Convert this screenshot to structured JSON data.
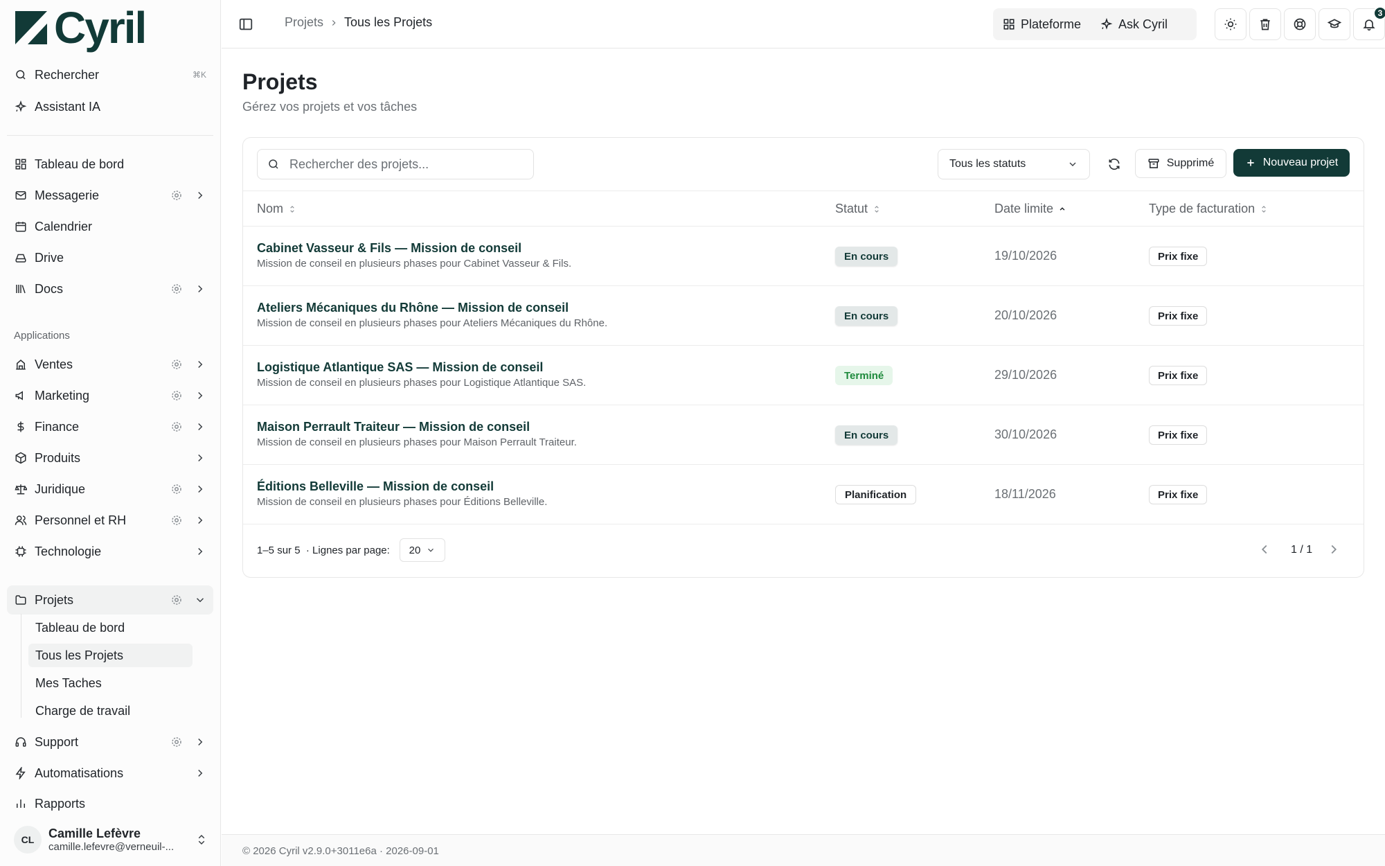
{
  "app": {
    "name": "Cyril"
  },
  "sidebar": {
    "search_label": "Rechercher",
    "search_shortcut": "⌘K",
    "assistant_label": "Assistant IA",
    "main_items": [
      {
        "label": "Tableau de bord",
        "icon": "dashboard-icon"
      },
      {
        "label": "Messagerie",
        "icon": "mail-icon"
      },
      {
        "label": "Calendrier",
        "icon": "calendar-icon"
      },
      {
        "label": "Drive",
        "icon": "drive-icon"
      },
      {
        "label": "Docs",
        "icon": "library-icon"
      }
    ],
    "applications_label": "Applications",
    "app_items": [
      {
        "label": "Ventes",
        "icon": "scales-icon"
      },
      {
        "label": "Marketing",
        "icon": "megaphone-icon"
      },
      {
        "label": "Finance",
        "icon": "dollar-icon"
      },
      {
        "label": "Produits",
        "icon": "box-icon"
      },
      {
        "label": "Juridique",
        "icon": "balance-icon"
      },
      {
        "label": "Personnel et RH",
        "icon": "users-icon"
      },
      {
        "label": "Technologie",
        "icon": "chip-icon"
      }
    ],
    "projects": {
      "label": "Projets",
      "sub_items": [
        "Tableau de bord",
        "Tous les Projets",
        "Mes Taches",
        "Charge de travail"
      ],
      "active_sub": "Tous les Projets"
    },
    "bottom_items": [
      {
        "label": "Support",
        "icon": "headset-icon"
      },
      {
        "label": "Automatisations",
        "icon": "bolt-icon"
      },
      {
        "label": "Rapports",
        "icon": "bar-chart-icon"
      }
    ],
    "user": {
      "initials": "CL",
      "name": "Camille Lefèvre",
      "email": "camille.lefevre@verneuil-..."
    }
  },
  "header": {
    "breadcrumb": [
      "Projets",
      "Tous les Projets"
    ],
    "platform_label": "Plateforme",
    "ask_label": "Ask Cyril",
    "notification_count": "3"
  },
  "main": {
    "title": "Projets",
    "subtitle": "Gérez vos projets et vos tâches",
    "search_placeholder": "Rechercher des projets...",
    "status_filter": "Tous les statuts",
    "deleted_label": "Supprimé",
    "new_project_label": "Nouveau projet",
    "columns": {
      "name": "Nom",
      "status": "Statut",
      "deadline": "Date limite",
      "billing": "Type de facturation"
    },
    "rows": [
      {
        "name": "Cabinet Vasseur & Fils — Mission de conseil",
        "description": "Mission de conseil en plusieurs phases pour Cabinet Vasseur & Fils.",
        "status": "En cours",
        "deadline": "19/10/2026",
        "billing": "Prix fixe"
      },
      {
        "name": "Ateliers Mécaniques du Rhône — Mission de conseil",
        "description": "Mission de conseil en plusieurs phases pour Ateliers Mécaniques du Rhône.",
        "status": "En cours",
        "deadline": "20/10/2026",
        "billing": "Prix fixe"
      },
      {
        "name": "Logistique Atlantique SAS — Mission de conseil",
        "description": "Mission de conseil en plusieurs phases pour Logistique Atlantique SAS.",
        "status": "Terminé",
        "deadline": "29/10/2026",
        "billing": "Prix fixe"
      },
      {
        "name": "Maison Perrault Traiteur — Mission de conseil",
        "description": "Mission de conseil en plusieurs phases pour Maison Perrault Traiteur.",
        "status": "En cours",
        "deadline": "30/10/2026",
        "billing": "Prix fixe"
      },
      {
        "name": "Éditions Belleville — Mission de conseil",
        "description": "Mission de conseil en plusieurs phases pour Éditions Belleville.",
        "status": "Planification",
        "deadline": "18/11/2026",
        "billing": "Prix fixe"
      }
    ],
    "pagination": {
      "range": "1–5 sur 5",
      "rows_per_page_label": "· Lignes par page:",
      "rows_per_page": "20",
      "page": "1 / 1"
    }
  },
  "footer": {
    "text": "© 2026 Cyril v2.9.0+3011e6a · 2026-09-01"
  },
  "colors": {
    "brand": "#123a37",
    "status_done": "#1e8a3c",
    "status_done_bg": "#e6f6ea",
    "status_running_bg": "#e3e8e8"
  }
}
